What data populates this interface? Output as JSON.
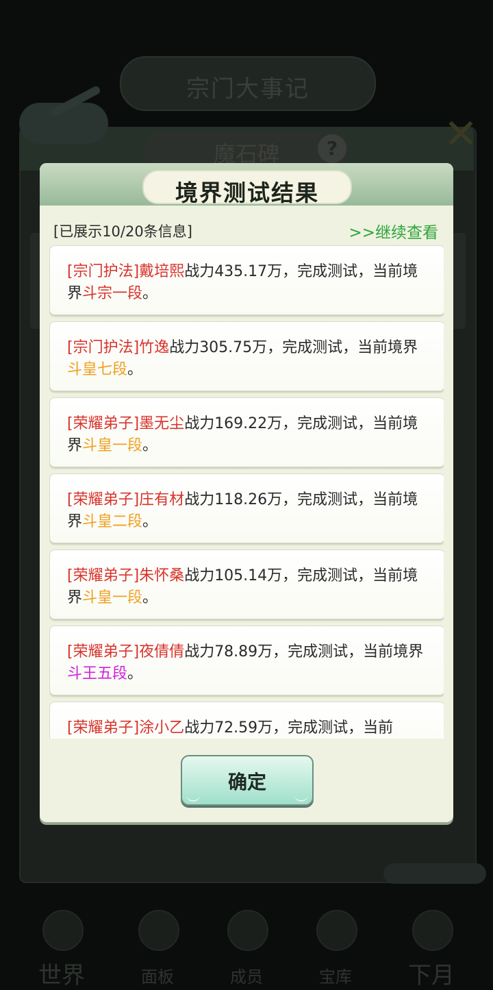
{
  "background": {
    "banner_title": "宗门大事记",
    "subtitle": "魔石碑",
    "help_glyph": "?",
    "close_glyph": "✕",
    "nav": [
      {
        "label": "世界",
        "icon": "world-icon"
      },
      {
        "label": "面板",
        "icon": "panel-icon"
      },
      {
        "label": "成员",
        "icon": "members-icon"
      },
      {
        "label": "宝库",
        "icon": "treasury-icon"
      },
      {
        "label": "下月",
        "icon": "next-month-icon"
      }
    ]
  },
  "dialog": {
    "title": "境界测试结果",
    "info_count": "[已展示10/20条信息]",
    "continue_label": ">>继续查看",
    "confirm_label": "确定",
    "colors": {
      "title_red": "#d8332b",
      "realm_orange": "#f0a020",
      "realm_magenta": "#d020e0",
      "link_green": "#2fa53e"
    }
  },
  "records": [
    {
      "title": "[宗门护法]",
      "name": "戴培熙",
      "power": "战力435.17万，完成测试，当前境界",
      "realm": "斗宗一段",
      "end": "。",
      "realm_color": "#d8332b"
    },
    {
      "title": "[宗门护法]",
      "name": "竹逸",
      "power": "战力305.75万，完成测试，当前境界",
      "realm": "斗皇七段",
      "end": "。",
      "realm_color": "#f0a020"
    },
    {
      "title": "[荣耀弟子]",
      "name": "墨无尘",
      "power": "战力169.22万，完成测试，当前境界",
      "realm": "斗皇一段",
      "end": "。",
      "realm_color": "#f0a020"
    },
    {
      "title": "[荣耀弟子]",
      "name": "庄有材",
      "power": "战力118.26万，完成测试，当前境界",
      "realm": "斗皇二段",
      "end": "。",
      "realm_color": "#f0a020"
    },
    {
      "title": "[荣耀弟子]",
      "name": "朱怀桑",
      "power": "战力105.14万，完成测试，当前境界",
      "realm": "斗皇一段",
      "end": "。",
      "realm_color": "#f0a020"
    },
    {
      "title": "[荣耀弟子]",
      "name": "夜倩倩",
      "power": "战力78.89万，完成测试，当前境界",
      "realm": "斗王五段",
      "end": "。",
      "realm_color": "#d020e0"
    },
    {
      "title": "[荣耀弟子]",
      "name": "涂小乙",
      "power": "战力72.59万，完成测试，当前",
      "realm": "",
      "end": "",
      "realm_color": "#f0a020"
    }
  ]
}
